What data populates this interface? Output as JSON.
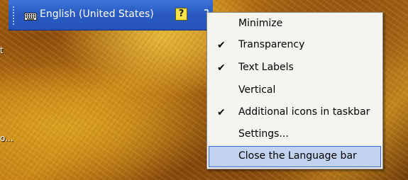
{
  "language_bar": {
    "language": "English (United States)",
    "help_glyph": "?",
    "options_glyph": "▿"
  },
  "desktop": {
    "label_fragment_1": "t",
    "label_fragment_2": "o..."
  },
  "context_menu": {
    "items": [
      {
        "label": "Minimize",
        "checked": false,
        "highlighted": false
      },
      {
        "label": "Transparency",
        "checked": true,
        "highlighted": false
      },
      {
        "label": "Text Labels",
        "checked": true,
        "highlighted": false
      },
      {
        "label": "Vertical",
        "checked": false,
        "highlighted": false
      },
      {
        "label": "Additional icons in taskbar",
        "checked": true,
        "highlighted": false
      },
      {
        "label": "Settings...",
        "checked": false,
        "highlighted": false
      },
      {
        "label": "Close the Language bar",
        "checked": false,
        "highlighted": true
      }
    ],
    "check_glyph": "✔",
    "highlight_color": "#c1d2ee"
  }
}
